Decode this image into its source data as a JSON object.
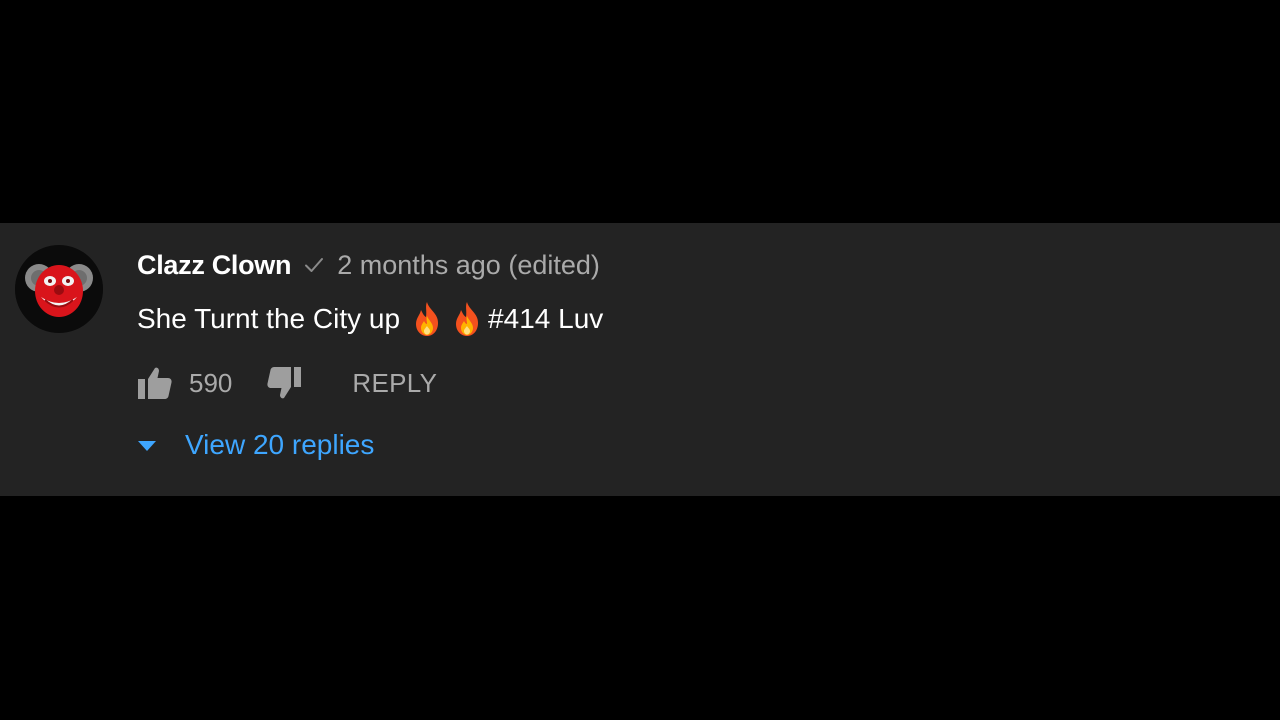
{
  "comment": {
    "author": "Clazz Clown",
    "verified": true,
    "timestamp": "2 months ago (edited)",
    "text_before": "She Turnt the City up",
    "emoji": [
      "fire-emoji",
      "fire-emoji"
    ],
    "text_after": "#414 Luv",
    "likes": "590",
    "reply_label": "REPLY",
    "view_replies_label": "View 20 replies"
  },
  "colors": {
    "background": "#000000",
    "card": "#232323",
    "author": "#ffffff",
    "muted": "#aaaaaa",
    "link": "#3ea6ff"
  }
}
